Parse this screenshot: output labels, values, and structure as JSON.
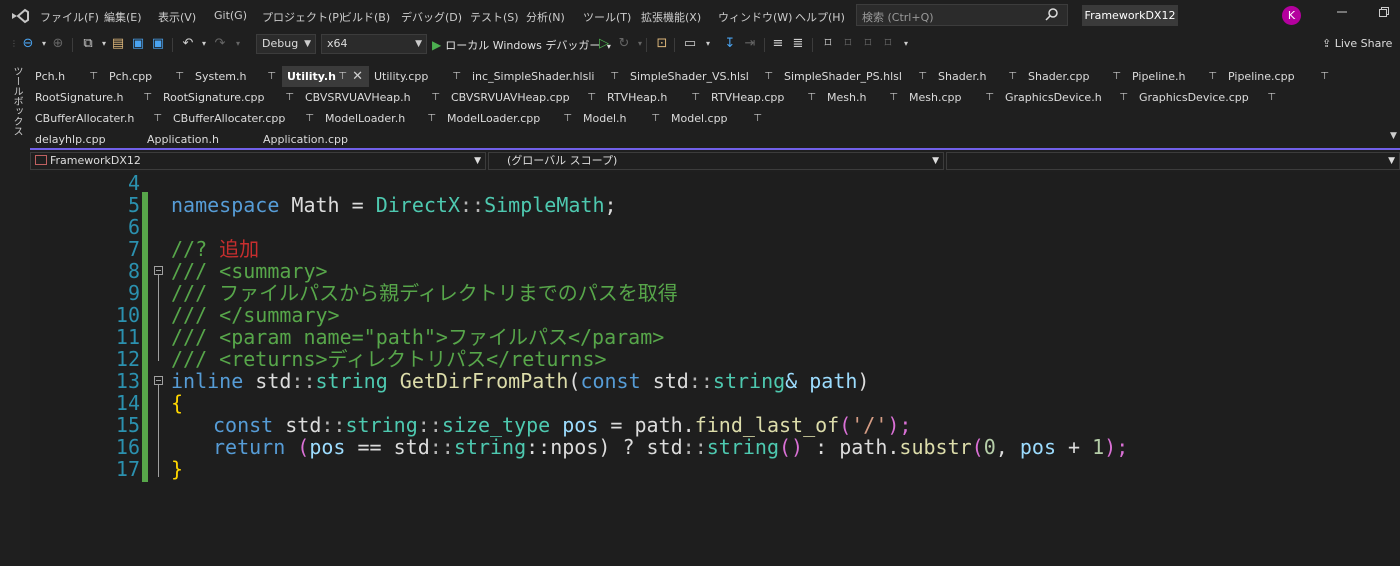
{
  "menu": {
    "items": [
      "ファイル(F)",
      "編集(E)",
      "表示(V)",
      "Git(G)",
      "プロジェクト(P)",
      "ビルド(B)",
      "デバッグ(D)",
      "テスト(S)",
      "分析(N)",
      "ツール(T)",
      "拡張機能(X)",
      "ウィンドウ(W)",
      "ヘルプ(H)"
    ],
    "search_placeholder": "検索 (Ctrl+Q)",
    "solution_name": "FrameworkDX12",
    "avatar_initial": "K"
  },
  "toolbar": {
    "config": "Debug",
    "platform": "x64",
    "run_label": "ローカル Windows デバッガー",
    "live_share": "Live Share"
  },
  "toolbox_label": "ツールボックス",
  "tabs": [
    {
      "label": "Pch.h",
      "pinned": true,
      "active": false
    },
    {
      "label": "Pch.cpp",
      "pinned": true,
      "active": false
    },
    {
      "label": "System.h",
      "pinned": true,
      "active": false
    },
    {
      "label": "Utility.h",
      "pinned": true,
      "active": true
    },
    {
      "label": "Utility.cpp",
      "pinned": true,
      "active": false
    },
    {
      "label": "inc_SimpleShader.hlsli",
      "pinned": true,
      "active": false
    },
    {
      "label": "SimpleShader_VS.hlsl",
      "pinned": true,
      "active": false
    },
    {
      "label": "SimpleShader_PS.hlsl",
      "pinned": true,
      "active": false
    },
    {
      "label": "Shader.h",
      "pinned": true,
      "active": false
    },
    {
      "label": "Shader.cpp",
      "pinned": true,
      "active": false
    },
    {
      "label": "Pipeline.h",
      "pinned": true,
      "active": false
    },
    {
      "label": "Pipeline.cpp",
      "pinned": true,
      "active": false
    },
    {
      "label": "RootSignature.h",
      "pinned": true,
      "active": false
    },
    {
      "label": "RootSignature.cpp",
      "pinned": true,
      "active": false
    },
    {
      "label": "CBVSRVUAVHeap.h",
      "pinned": true,
      "active": false
    },
    {
      "label": "CBVSRVUAVHeap.cpp",
      "pinned": true,
      "active": false
    },
    {
      "label": "RTVHeap.h",
      "pinned": true,
      "active": false
    },
    {
      "label": "RTVHeap.cpp",
      "pinned": true,
      "active": false
    },
    {
      "label": "Mesh.h",
      "pinned": true,
      "active": false
    },
    {
      "label": "Mesh.cpp",
      "pinned": true,
      "active": false
    },
    {
      "label": "GraphicsDevice.h",
      "pinned": true,
      "active": false
    },
    {
      "label": "GraphicsDevice.cpp",
      "pinned": true,
      "active": false
    },
    {
      "label": "CBufferAllocater.h",
      "pinned": true,
      "active": false
    },
    {
      "label": "CBufferAllocater.cpp",
      "pinned": true,
      "active": false
    },
    {
      "label": "ModelLoader.h",
      "pinned": true,
      "active": false
    },
    {
      "label": "ModelLoader.cpp",
      "pinned": true,
      "active": false
    },
    {
      "label": "Model.h",
      "pinned": true,
      "active": false
    },
    {
      "label": "Model.cpp",
      "pinned": true,
      "active": false
    },
    {
      "label": "delayhlp.cpp",
      "pinned": false,
      "active": false
    },
    {
      "label": "Application.h",
      "pinned": false,
      "active": false
    },
    {
      "label": "Application.cpp",
      "pinned": false,
      "active": false
    }
  ],
  "navbar": {
    "project": "FrameworkDX12",
    "scope": "(グローバル スコープ)",
    "member": ""
  },
  "editor": {
    "line_numbers": [
      "4",
      "5",
      "6",
      "7",
      "8",
      "9",
      "10",
      "11",
      "12",
      "13",
      "14",
      "15",
      "16",
      "17"
    ],
    "lines": {
      "l5": {
        "kw": "namespace",
        "a": " Math = ",
        "b": "DirectX",
        "c": "::",
        "d": "SimpleMath",
        "e": ";"
      },
      "l7": {
        "a": "//? ",
        "b": "追加"
      },
      "l8": "/// <summary>",
      "l9": "/// ファイルパスから親ディレクトリまでのパスを取得",
      "l10": "/// </summary>",
      "l11": "/// <param name=\"path\">ファイルパス</param>",
      "l12": "/// <returns>ディレクトリパス</returns>",
      "l13": {
        "kw": "inline",
        "a": " std",
        "b": "::",
        "c": "string",
        "d": " GetDirFromPath",
        "e": "(",
        "f": "const",
        "g": " std",
        "h": "::",
        "i": "string",
        "j": "& path",
        "k": ")"
      },
      "l14": "{",
      "l15": {
        "kw": "const",
        "a": " std",
        "b": "::",
        "c": "string",
        "d": "::",
        "e": "size_type",
        "f": " pos",
        "g": " = path.",
        "h": "find_last_of",
        "i": "(",
        "j": "'/'",
        "k": ");"
      },
      "l16": {
        "kw": "return",
        "a": " (",
        "b": "pos",
        "c": " == std",
        "d": "::",
        "e": "string",
        "f": "::npos) ? std",
        "g": "::",
        "h": "string",
        "i": "()",
        "j": " : path.",
        "k": "substr",
        "l": "(",
        "m": "0",
        "n": ", ",
        "o": "pos",
        "p": " + ",
        "q": "1",
        "r": ");"
      },
      "l17": "}"
    }
  }
}
